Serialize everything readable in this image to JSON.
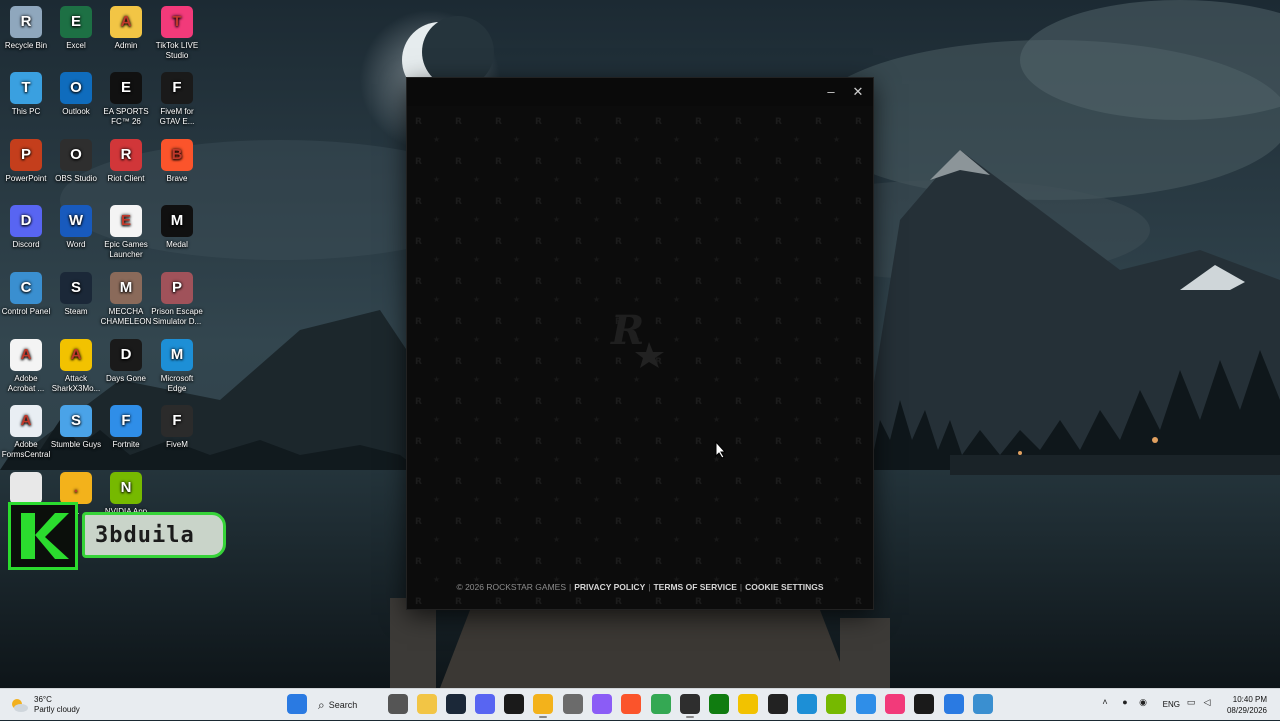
{
  "desktop": {
    "icons": [
      {
        "label": "Recycle Bin",
        "icon": "recycle-bin-icon",
        "color": "#8fa7bd"
      },
      {
        "label": "Excel",
        "icon": "excel-icon",
        "color": "#1d7044"
      },
      {
        "label": "Admin",
        "icon": "folder-icon",
        "color": "#f2c545"
      },
      {
        "label": "TikTok LIVE Studio",
        "icon": "tiktok-icon",
        "color": "#f23a7a"
      },
      {
        "label": "This PC",
        "icon": "monitor-icon",
        "color": "#3aa0e0"
      },
      {
        "label": "Outlook",
        "icon": "outlook-icon",
        "color": "#0f6cbd"
      },
      {
        "label": "EA SPORTS FC™ 26",
        "icon": "ea-fc-icon",
        "color": "#111111"
      },
      {
        "label": "FiveM for GTAV E...",
        "icon": "fivem-icon",
        "color": "#1a1a1a"
      },
      {
        "label": "PowerPoint",
        "icon": "powerpoint-icon",
        "color": "#c43e1c"
      },
      {
        "label": "OBS Studio",
        "icon": "obs-icon",
        "color": "#2e2e2e"
      },
      {
        "label": "Riot Client",
        "icon": "riot-icon",
        "color": "#d13639"
      },
      {
        "label": "Brave",
        "icon": "brave-icon",
        "color": "#fb542b"
      },
      {
        "label": "Discord",
        "icon": "discord-icon",
        "color": "#5865f2"
      },
      {
        "label": "Word",
        "icon": "word-icon",
        "color": "#185abd"
      },
      {
        "label": "Epic Games Launcher",
        "icon": "file-icon",
        "color": "#f4f4f4"
      },
      {
        "label": "Medal",
        "icon": "medal-icon",
        "color": "#101010"
      },
      {
        "label": "Control Panel",
        "icon": "control-panel-icon",
        "color": "#3a8fd0"
      },
      {
        "label": "Steam",
        "icon": "steam-icon",
        "color": "#1b2838"
      },
      {
        "label": "MECCHA CHAMELEON",
        "icon": "game-icon",
        "color": "#8a6a5a"
      },
      {
        "label": "Prison Escape Simulator D...",
        "icon": "game-icon",
        "color": "#a0525a"
      },
      {
        "label": "Adobe Acrobat ...",
        "icon": "acrobat-icon",
        "color": "#f4f4f4"
      },
      {
        "label": "Attack SharkX3Mo...",
        "icon": "shark-icon",
        "color": "#f2c200"
      },
      {
        "label": "Days Gone",
        "icon": "days-gone-icon",
        "color": "#1a1a1a"
      },
      {
        "label": "Microsoft Edge",
        "icon": "edge-icon",
        "color": "#1d8fd6"
      },
      {
        "label": "Adobe FormsCentral",
        "icon": "forms-icon",
        "color": "#e9eef3"
      },
      {
        "label": "Stumble Guys",
        "icon": "stumble-icon",
        "color": "#4aa3e8"
      },
      {
        "label": "Fortnite",
        "icon": "fortnite-icon",
        "color": "#2f8ee8"
      },
      {
        "label": "FiveM",
        "icon": "fivem-icon",
        "color": "#2b2b2b"
      },
      {
        "label": "",
        "icon": "chrome-icon",
        "color": "#e8e8e8"
      },
      {
        "label": "...",
        "icon": "rockstar-icon",
        "color": "#f3b21b"
      },
      {
        "label": "NVIDIA App",
        "icon": "nvidia-icon",
        "color": "#76b900"
      }
    ]
  },
  "overlay": {
    "letter": "K",
    "name": "3bduila",
    "accent": "#2bdc2e"
  },
  "launcher": {
    "minimize": "–",
    "close": "✕",
    "logo": "rockstar-logo",
    "footer": {
      "copyright": "© 2026 ROCKSTAR GAMES",
      "privacy": "PRIVACY POLICY",
      "terms": "TERMS OF SERVICE",
      "cookies": "COOKIE SETTINGS",
      "separator": "|"
    }
  },
  "taskbar": {
    "weather": {
      "temp": "36°C",
      "condition": "Partly cloudy"
    },
    "search_label": "Search",
    "apps": [
      {
        "icon": "start-icon",
        "color": "#2a7ae2"
      },
      {
        "icon": "task-view-icon",
        "color": "#555555"
      },
      {
        "icon": "file-explorer-icon",
        "color": "#f2c545"
      },
      {
        "icon": "steam-icon",
        "color": "#1b2838"
      },
      {
        "icon": "discord-icon",
        "color": "#5865f2"
      },
      {
        "icon": "fivem-icon",
        "color": "#1a1a1a"
      },
      {
        "icon": "rockstar-icon",
        "color": "#f3b21b"
      },
      {
        "icon": "settings-icon",
        "color": "#6b6b6b"
      },
      {
        "icon": "app-icon",
        "color": "#8b5cf6"
      },
      {
        "icon": "brave-icon",
        "color": "#fb542b"
      },
      {
        "icon": "chrome-icon",
        "color": "#34a853"
      },
      {
        "icon": "obs-icon",
        "color": "#2e2e2e"
      },
      {
        "icon": "xbox-icon",
        "color": "#107c10"
      },
      {
        "icon": "shark-icon",
        "color": "#f2c200"
      },
      {
        "icon": "ea-icon",
        "color": "#222222"
      },
      {
        "icon": "edge-icon",
        "color": "#1d8fd6"
      },
      {
        "icon": "nvidia-icon",
        "color": "#76b900"
      },
      {
        "icon": "fortnite-icon",
        "color": "#2f8ee8"
      },
      {
        "icon": "tiktok-icon",
        "color": "#f23a7a"
      },
      {
        "icon": "fivem-icon",
        "color": "#1a1a1a"
      },
      {
        "icon": "store-icon",
        "color": "#2a7ae2"
      },
      {
        "icon": "app-installer-icon",
        "color": "#3a8fd0"
      }
    ],
    "tray": {
      "language": "ENG",
      "time": "10:40 PM",
      "date": "08/29/2026"
    }
  }
}
